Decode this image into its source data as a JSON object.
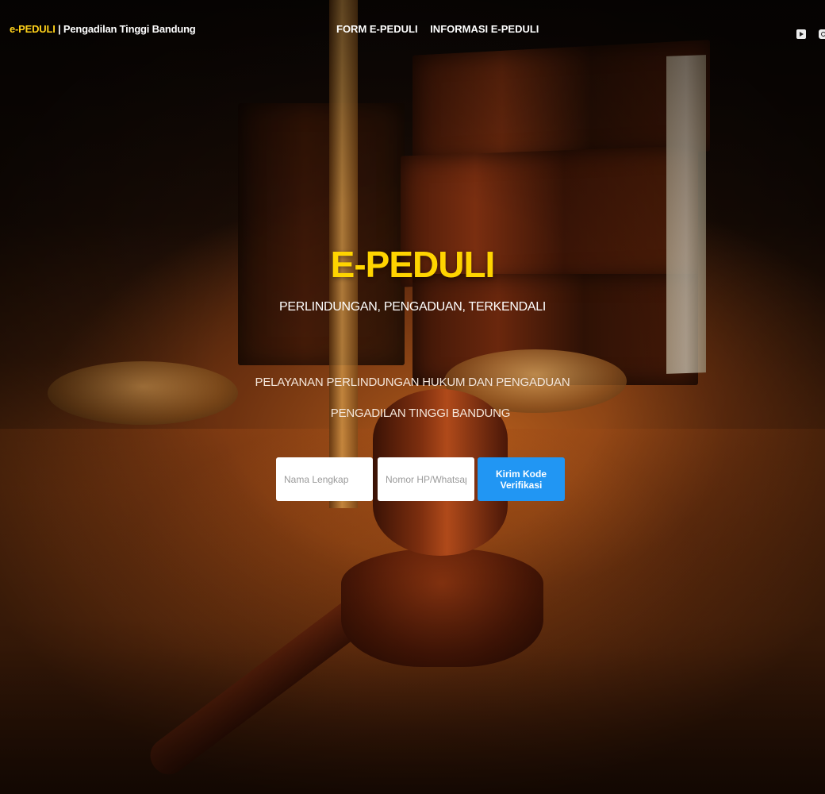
{
  "header": {
    "brand_accent": "e-PEDULI",
    "brand_rest": " | Pengadilan Tinggi Bandung",
    "nav": [
      {
        "label": "FORM E-PEDULI"
      },
      {
        "label": "INFORMASI E-PEDULI"
      }
    ],
    "social_icons": [
      "youtube-icon",
      "instagram-icon"
    ]
  },
  "hero": {
    "title": "E-PEDULI",
    "tagline": "PERLINDUNGAN, PENGADUAN, TERKENDALI",
    "description_line1": "PELAYANAN PERLINDUNGAN HUKUM DAN PENGADUAN",
    "description_line2": "PENGADILAN TINGGI BANDUNG"
  },
  "form": {
    "name_placeholder": "Nama Lengkap",
    "name_value": "",
    "phone_placeholder": "Nomor HP/Whatsapp",
    "phone_value": "",
    "submit_label": "Kirim Kode Verifikasi"
  },
  "colors": {
    "accent_yellow": "#ffd400",
    "button_blue": "#2196f3"
  }
}
